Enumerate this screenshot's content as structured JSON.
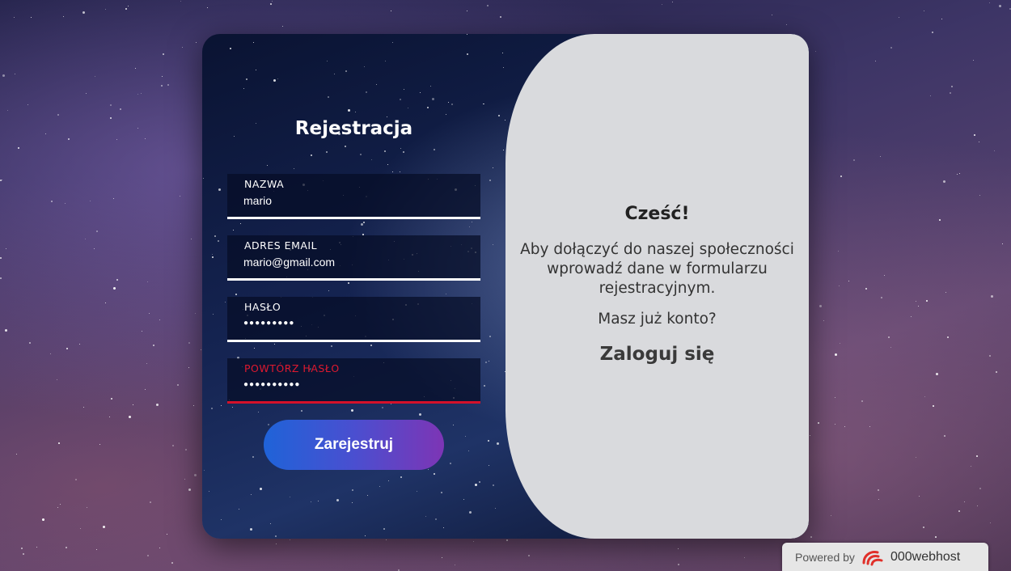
{
  "form": {
    "title": "Rejestracja",
    "fields": [
      {
        "label": "NAZWA",
        "value": "mario",
        "type": "text",
        "state": "normal"
      },
      {
        "label": "ADRES EMAIL",
        "value": "mario@gmail.com",
        "type": "text",
        "state": "normal"
      },
      {
        "label": "HASŁO",
        "value": "●●●●●●●●●",
        "type": "password",
        "state": "normal"
      },
      {
        "label": "POWTÓRZ HASŁO",
        "value": "●●●●●●●●●●",
        "type": "password",
        "state": "error"
      }
    ],
    "submit_label": "Zarejestruj"
  },
  "panel": {
    "heading": "Cześć!",
    "description": "Aby dołączyć do naszej społeczności wprowadź dane w formularzu rejestracyjnym.",
    "question": "Masz już konto?",
    "login_link": "Zaloguj się"
  },
  "badge": {
    "powered_by": "Powered by",
    "host": "000webhost"
  },
  "colors": {
    "error": "#d4112a",
    "button_start": "#1f63d8",
    "button_end": "#7d35b5",
    "panel_bg": "#d9dadd"
  }
}
